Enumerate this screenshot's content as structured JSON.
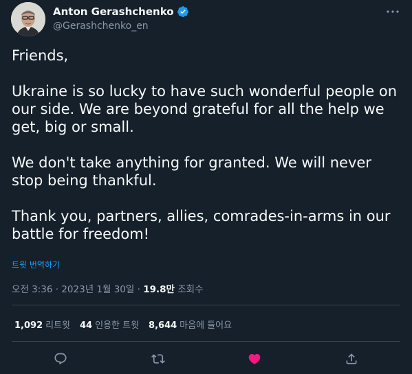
{
  "author": {
    "name": "Anton Gerashchenko",
    "handle": "@Gerashchenko_en",
    "verified": true
  },
  "tweet": {
    "paragraphs": [
      "Friends,",
      "Ukraine is so lucky to have such wonderful people on our side. We are beyond grateful for all the help we get, big or small.",
      "We don't take anything for granted. We will never stop being thankful.",
      "Thank you, partners, allies, comrades-in-arms in our battle for freedom!"
    ],
    "translate_label": "트윗 번역하기"
  },
  "meta": {
    "time": "오전 3:36",
    "date": "2023년 1월 30일",
    "separator": "·",
    "views": "19.8만",
    "views_label": "조회수"
  },
  "stats": {
    "retweets": "1,092",
    "retweets_label": "리트윗",
    "quotes": "44",
    "quotes_label": "인용한 트윗",
    "likes": "8,644",
    "likes_label": "마음에 들어요"
  },
  "actions": [
    "reply",
    "retweet",
    "like",
    "share"
  ],
  "colors": {
    "background": "#15202b",
    "text": "#f7f9f9",
    "secondary": "#8b98a5",
    "link": "#1d9bf0",
    "like": "#f91880",
    "divider": "#38444d"
  }
}
